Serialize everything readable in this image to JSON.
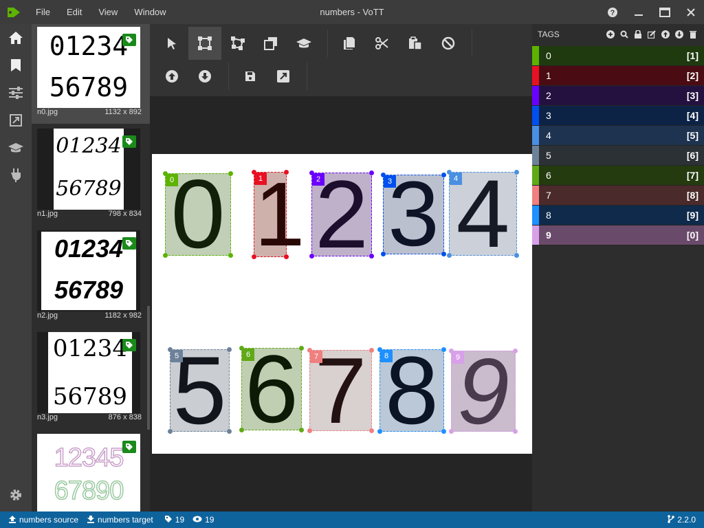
{
  "window": {
    "title": "numbers - VoTT",
    "menu": [
      "File",
      "Edit",
      "View",
      "Window"
    ],
    "controls": [
      "help-icon",
      "minimize-icon",
      "maximize-icon",
      "close-icon"
    ]
  },
  "nav": [
    "home-icon",
    "bookmark-icon",
    "sliders-icon",
    "export-icon",
    "graduation-cap-icon",
    "plug-icon",
    "gear-icon"
  ],
  "thumbnails": [
    {
      "name": "n0.jpg",
      "size": "1132 x 892",
      "rows": [
        "01234",
        "56789"
      ]
    },
    {
      "name": "n1.jpg",
      "size": "798 x 834",
      "rows": [
        "01234",
        "56789"
      ]
    },
    {
      "name": "n2.jpg",
      "size": "1182 x 982",
      "rows": [
        "01234",
        "56789"
      ]
    },
    {
      "name": "n3.jpg",
      "size": "876 x 838",
      "rows": [
        "01234",
        "56789"
      ]
    },
    {
      "name": "",
      "size": "",
      "rows": [
        "12345",
        "67890"
      ]
    }
  ],
  "toolbar": {
    "row1": [
      "select-icon",
      "rectangle-icon",
      "polygon-icon",
      "copy-region-icon",
      "active-learning-icon",
      "copy-icon",
      "cut-icon",
      "paste-icon",
      "clear-icon"
    ],
    "row2": [
      "previous-asset-icon",
      "next-asset-icon",
      "save-icon",
      "export-icon"
    ]
  },
  "regions": [
    {
      "tag": "0",
      "color": "#5db300",
      "fill": "rgba(130,160,110,0.5)"
    },
    {
      "tag": "1",
      "color": "#e81123",
      "fill": "rgba(160,100,90,0.5)"
    },
    {
      "tag": "2",
      "color": "#6a00ff",
      "fill": "rgba(130,100,150,0.5)"
    },
    {
      "tag": "3",
      "color": "#0050ef",
      "fill": "rgba(120,130,160,0.5)"
    },
    {
      "tag": "4",
      "color": "#4a90e2",
      "fill": "rgba(140,150,170,0.45)"
    },
    {
      "tag": "5",
      "color": "#6d8299",
      "fill": "rgba(150,155,165,0.5)"
    },
    {
      "tag": "6",
      "color": "#60a917",
      "fill": "rgba(130,160,100,0.5)"
    },
    {
      "tag": "7",
      "color": "#f08080",
      "fill": "rgba(170,150,150,0.45)"
    },
    {
      "tag": "8",
      "color": "#1e90ff",
      "fill": "rgba(120,145,175,0.5)"
    },
    {
      "tag": "9",
      "color": "#d8a0e8",
      "fill": "rgba(150,120,155,0.5)"
    }
  ],
  "tags_panel": {
    "title": "TAGS",
    "tools": [
      "add-icon",
      "search-icon",
      "lock-icon",
      "edit-icon",
      "move-up-icon",
      "move-down-icon",
      "delete-icon"
    ],
    "items": [
      {
        "name": "0",
        "hotkey": "[1]",
        "color": "#5db300",
        "bg": "#1e3a0e"
      },
      {
        "name": "1",
        "hotkey": "[2]",
        "color": "#e81123",
        "bg": "#4a0c12"
      },
      {
        "name": "2",
        "hotkey": "[3]",
        "color": "#6a00ff",
        "bg": "#25113f"
      },
      {
        "name": "3",
        "hotkey": "[4]",
        "color": "#0050ef",
        "bg": "#0d2346"
      },
      {
        "name": "4",
        "hotkey": "[5]",
        "color": "#4a90e2",
        "bg": "#1d3350"
      },
      {
        "name": "5",
        "hotkey": "[6]",
        "color": "#6d8299",
        "bg": "#2c3136"
      },
      {
        "name": "6",
        "hotkey": "[7]",
        "color": "#60a917",
        "bg": "#243a0f"
      },
      {
        "name": "7",
        "hotkey": "[8]",
        "color": "#f08080",
        "bg": "#4a2a2a"
      },
      {
        "name": "8",
        "hotkey": "[9]",
        "color": "#1e90ff",
        "bg": "#0f2a4a"
      },
      {
        "name": "9",
        "hotkey": "[0]",
        "color": "#d8a0e8",
        "bg": "#6a4a6a"
      }
    ]
  },
  "status": {
    "source": "numbers source",
    "target": "numbers target",
    "tagged": "19",
    "visited": "19",
    "version": "2.2.0"
  }
}
